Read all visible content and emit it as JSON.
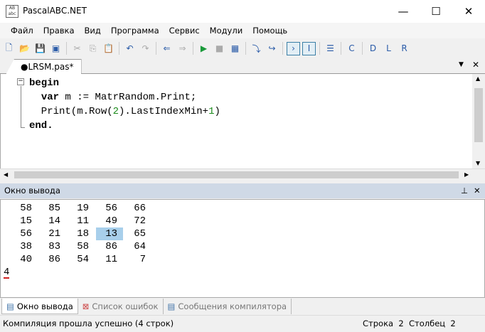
{
  "window": {
    "title": "PascalABC.NET",
    "app_icon_text": "AB abc",
    "minimize": "—",
    "maximize": "☐",
    "close": "✕"
  },
  "menu": [
    "Файл",
    "Правка",
    "Вид",
    "Программа",
    "Сервис",
    "Модули",
    "Помощь"
  ],
  "toolbar": [
    "new-file",
    "open",
    "save",
    "save-all",
    "cut",
    "copy",
    "paste",
    "undo",
    "redo",
    "navigate-back",
    "navigate-forward",
    "run",
    "stop",
    "compile",
    "debug-step-into",
    "debug-step-over",
    "output-window",
    "console",
    "format",
    "code-templates",
    "doc-d",
    "doc-l",
    "doc-r"
  ],
  "editor": {
    "tab_label": "●LRSM.pas*",
    "tab_menu": "▼",
    "tab_close": "✕",
    "lines": [
      {
        "parts": [
          {
            "t": "begin",
            "c": "kw"
          }
        ]
      },
      {
        "parts": [
          {
            "t": "  "
          },
          {
            "t": "var",
            "c": "kw"
          },
          {
            "t": " m := MatrRandom.Print;"
          }
        ]
      },
      {
        "parts": [
          {
            "t": "  Print(m.Row("
          },
          {
            "t": "2",
            "c": "num"
          },
          {
            "t": ").LastIndexMin+"
          },
          {
            "t": "1",
            "c": "num"
          },
          {
            "t": ")"
          }
        ]
      },
      {
        "parts": [
          {
            "t": "end.",
            "c": "kw"
          }
        ]
      }
    ]
  },
  "output": {
    "title": "Окно вывода",
    "pin": "⊥",
    "close": "✕",
    "matrix": [
      [
        "58",
        "85",
        "19",
        "56",
        "66"
      ],
      [
        "15",
        "14",
        "11",
        "49",
        "72"
      ],
      [
        "56",
        "21",
        "18",
        "13",
        "65"
      ],
      [
        "38",
        "83",
        "58",
        "86",
        "64"
      ],
      [
        "40",
        "86",
        "54",
        "11",
        "7"
      ]
    ],
    "highlight": {
      "row": 2,
      "col": 3
    },
    "result": "4"
  },
  "bottom_tabs": [
    "Окно вывода",
    "Список ошибок",
    "Сообщения компилятора"
  ],
  "status": {
    "message": "Компиляция прошла успешно (4 строк)",
    "position": "Строка  2  Столбец  2"
  }
}
